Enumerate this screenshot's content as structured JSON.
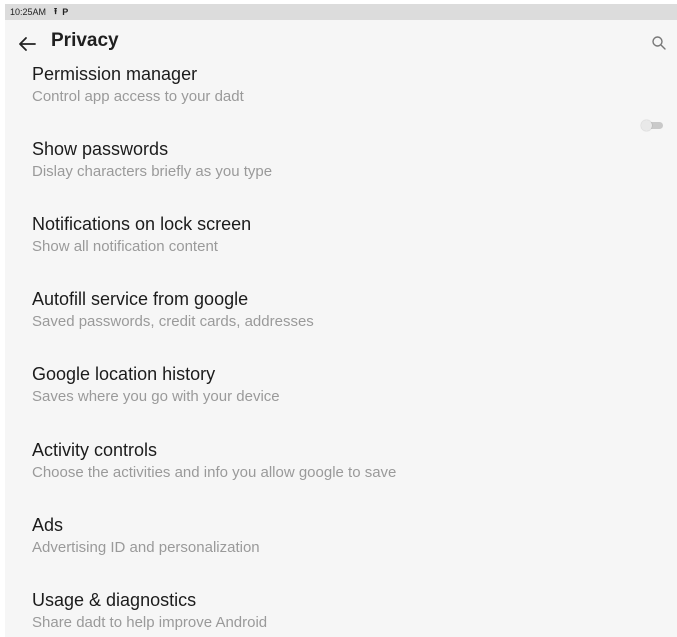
{
  "status_bar": {
    "time": "10:25AM",
    "icons": [
      "upload-icon",
      "parking-icon"
    ]
  },
  "header": {
    "title": "Privacy",
    "back_icon": "arrow-left-icon",
    "search_icon": "search-icon"
  },
  "items": [
    {
      "title": "Permission manager",
      "subtitle": "Control app access to your dadt"
    },
    {
      "title": "Show passwords",
      "subtitle": "Dislay characters briefly as you type",
      "toggle": false
    },
    {
      "title": "Notifications on lock screen",
      "subtitle": "Show all notification content"
    },
    {
      "title": "Autofill service from google",
      "subtitle": "Saved passwords, credit cards, addresses"
    },
    {
      "title": "Google location history",
      "subtitle": "Saves where you go with your device"
    },
    {
      "title": "Activity controls",
      "subtitle": "Choose the activities and info you allow google to save"
    },
    {
      "title": "Ads",
      "subtitle": "Advertising ID and personalization"
    },
    {
      "title": "Usage & diagnostics",
      "subtitle": "Share dadt to help improve Android"
    }
  ],
  "colors": {
    "background": "#f6f6f6",
    "status_bar": "#dcdcdc",
    "title_text": "#1c1c1c",
    "subtitle_text": "#9a9a9a"
  }
}
